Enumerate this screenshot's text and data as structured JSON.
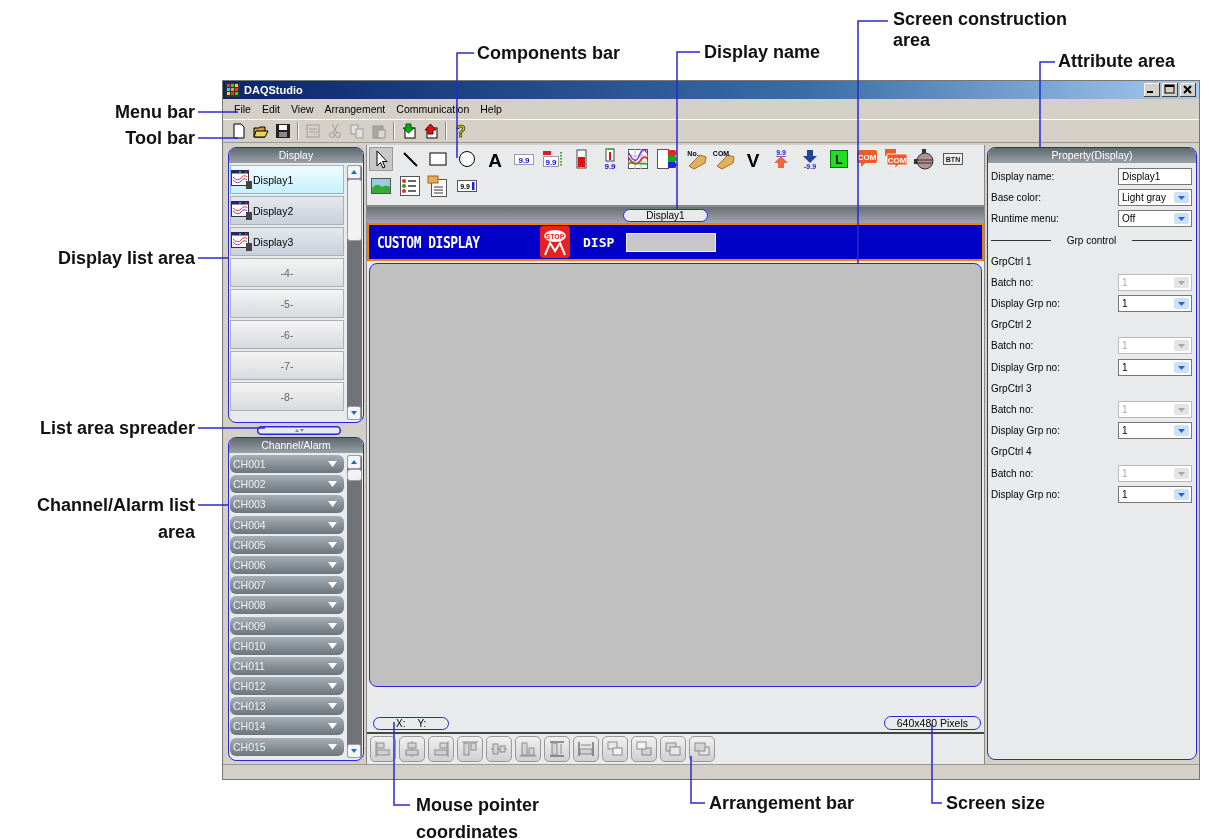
{
  "window": {
    "title": "DAQStudio",
    "controls": [
      {
        "kind": "minimize"
      },
      {
        "kind": "maximize"
      },
      {
        "kind": "close"
      }
    ]
  },
  "menu_bar": [
    "File",
    "Edit",
    "View",
    "Arrangement",
    "Communication",
    "Help"
  ],
  "tool_bar": [
    {
      "kind": "new",
      "disabled": false
    },
    {
      "kind": "open",
      "disabled": false
    },
    {
      "kind": "save",
      "disabled": false
    },
    {
      "kind": "separator"
    },
    {
      "kind": "edit",
      "disabled": true
    },
    {
      "kind": "cut",
      "disabled": true
    },
    {
      "kind": "copy",
      "disabled": true
    },
    {
      "kind": "paste",
      "disabled": true
    },
    {
      "kind": "separator"
    },
    {
      "kind": "download",
      "disabled": false
    },
    {
      "kind": "upload",
      "disabled": false
    },
    {
      "kind": "separator"
    },
    {
      "kind": "help",
      "glyph": "?",
      "disabled": false
    }
  ],
  "display_list": {
    "title": "Display",
    "items": [
      {
        "kind": "display",
        "label": "Display1",
        "selected": true
      },
      {
        "kind": "display",
        "label": "Display2",
        "selected": false
      },
      {
        "kind": "display",
        "label": "Display3",
        "selected": false
      },
      {
        "kind": "empty",
        "label": "-4-",
        "selected": false
      },
      {
        "kind": "empty",
        "label": "-5-",
        "selected": false
      },
      {
        "kind": "empty",
        "label": "-6-",
        "selected": false
      },
      {
        "kind": "empty",
        "label": "-7-",
        "selected": false
      },
      {
        "kind": "empty",
        "label": "-8-",
        "selected": false
      }
    ]
  },
  "channel_list": {
    "title": "Channel/Alarm",
    "items": [
      "CH001",
      "CH002",
      "CH003",
      "CH004",
      "CH005",
      "CH006",
      "CH007",
      "CH008",
      "CH009",
      "CH010",
      "CH011",
      "CH012",
      "CH013",
      "CH014",
      "CH015"
    ]
  },
  "components_bar": [
    {
      "kind": "pointer",
      "selected": true
    },
    {
      "kind": "line",
      "selected": false
    },
    {
      "kind": "rect",
      "selected": false
    },
    {
      "kind": "circle",
      "selected": false
    },
    {
      "kind": "text",
      "glyph": "A",
      "selected": false
    },
    {
      "kind": "digital",
      "glyph": "9.9",
      "selected": false
    },
    {
      "kind": "digital_tag",
      "glyph": "9.9",
      "selected": false
    },
    {
      "kind": "bar",
      "selected": false
    },
    {
      "kind": "bar_digital",
      "glyph": "9.9",
      "selected": false
    },
    {
      "kind": "trend",
      "selected": false
    },
    {
      "kind": "alarm",
      "selected": false
    },
    {
      "kind": "tag",
      "glyph": "No.",
      "selected": false
    },
    {
      "kind": "tag",
      "glyph": "COM",
      "selected": false
    },
    {
      "kind": "letter",
      "glyph": "V",
      "selected": false
    },
    {
      "kind": "up",
      "glyph": "9.9",
      "selected": false
    },
    {
      "kind": "down",
      "glyph": "-9.9",
      "selected": false
    },
    {
      "kind": "lamp",
      "glyph": "L",
      "selected": false
    },
    {
      "kind": "comment",
      "glyph": "COM",
      "selected": false
    },
    {
      "kind": "comments",
      "glyph": "COM",
      "selected": false
    },
    {
      "kind": "knob",
      "selected": false
    },
    {
      "kind": "button",
      "glyph": "BTN",
      "selected": false
    },
    {
      "kind": "image",
      "selected": false
    },
    {
      "kind": "list",
      "selected": false
    },
    {
      "kind": "form",
      "selected": false
    },
    {
      "kind": "input",
      "glyph": "9.9",
      "selected": false
    }
  ],
  "display_tab": {
    "label": "Display1"
  },
  "display_header": {
    "title": "CUSTOM DISPLAY",
    "stop_icon_text": "STOP",
    "label": "DISP"
  },
  "status": {
    "coordinates": [
      "X:",
      "Y:"
    ],
    "screen_size": "640x480 Pixels"
  },
  "arrangement_bar": [
    {
      "kind": "align_left",
      "disabled": true
    },
    {
      "kind": "align_center",
      "disabled": true
    },
    {
      "kind": "align_right",
      "disabled": true
    },
    {
      "kind": "align_top",
      "disabled": true
    },
    {
      "kind": "align_middle",
      "disabled": true
    },
    {
      "kind": "align_bottom",
      "disabled": true
    },
    {
      "kind": "same_height",
      "disabled": true
    },
    {
      "kind": "same_width",
      "disabled": true
    },
    {
      "kind": "bring_front",
      "disabled": true
    },
    {
      "kind": "send_back",
      "disabled": true
    },
    {
      "kind": "forward",
      "disabled": true
    },
    {
      "kind": "backward",
      "disabled": true
    }
  ],
  "property_panel": {
    "title": "Property(Display)",
    "rows": [
      {
        "kind": "text_field",
        "label": "Display name:",
        "value": "Display1"
      },
      {
        "kind": "dropdown",
        "label": "Base color:",
        "value": "Light gray",
        "disabled": false
      },
      {
        "kind": "dropdown",
        "label": "Runtime menu:",
        "value": "Off",
        "disabled": false
      },
      {
        "kind": "section",
        "label": "Grp control"
      },
      {
        "kind": "heading",
        "label": "GrpCtrl 1"
      },
      {
        "kind": "dropdown",
        "label": "Batch no:",
        "value": "1",
        "disabled": true
      },
      {
        "kind": "dropdown",
        "label": "Display Grp no:",
        "value": "1",
        "disabled": false
      },
      {
        "kind": "heading",
        "label": "GrpCtrl 2"
      },
      {
        "kind": "dropdown",
        "label": "Batch no:",
        "value": "1",
        "disabled": true
      },
      {
        "kind": "dropdown",
        "label": "Display Grp no:",
        "value": "1",
        "disabled": false
      },
      {
        "kind": "heading",
        "label": "GrpCtrl 3"
      },
      {
        "kind": "dropdown",
        "label": "Batch no:",
        "value": "1",
        "disabled": true
      },
      {
        "kind": "dropdown",
        "label": "Display Grp no:",
        "value": "1",
        "disabled": false
      },
      {
        "kind": "heading",
        "label": "GrpCtrl 4"
      },
      {
        "kind": "dropdown",
        "label": "Batch no:",
        "value": "1",
        "disabled": true
      },
      {
        "kind": "dropdown",
        "label": "Display Grp no:",
        "value": "1",
        "disabled": false
      }
    ]
  },
  "callouts": [
    "Components bar",
    "Display name",
    "Screen construction area",
    "Attribute area",
    "Menu bar",
    "Tool bar",
    "Display list area",
    "List area spreader",
    "Channel/Alarm list area",
    "Mouse pointer coordinates",
    "Arrangement bar",
    "Screen size"
  ]
}
